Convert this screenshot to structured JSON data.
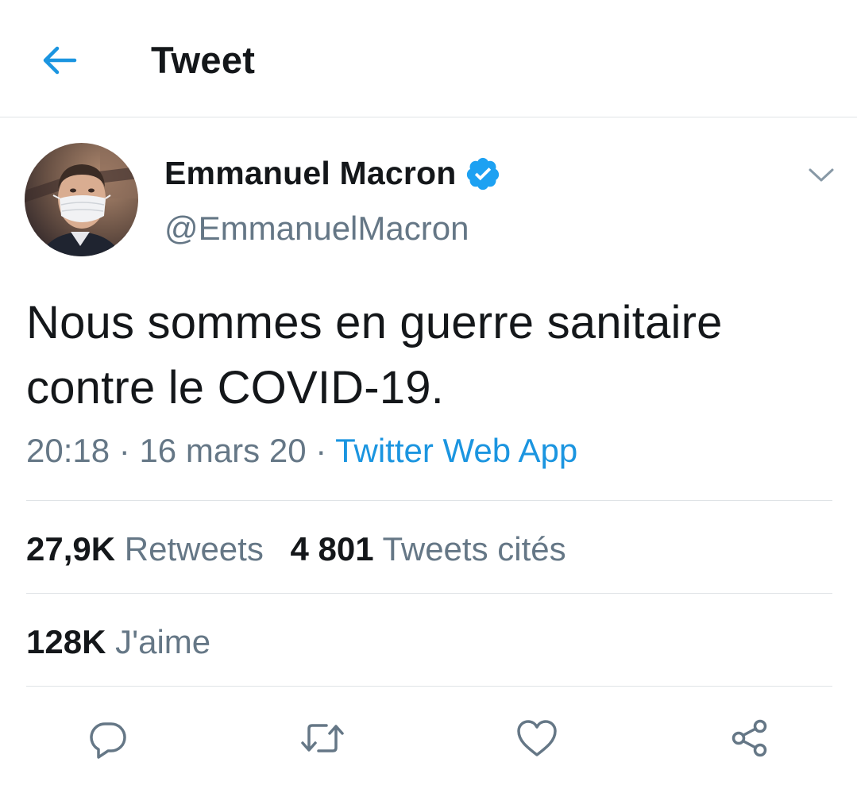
{
  "header": {
    "back_icon": "arrow-left-icon",
    "title": "Tweet",
    "accent_color": "#1b95e0"
  },
  "author": {
    "name": "Emmanuel Macron",
    "handle": "@EmmanuelMacron",
    "verified": true,
    "verified_color": "#1da1f2",
    "avatar_icon": "profile-photo"
  },
  "tweet": {
    "line1": "Nous sommes en guerre sanitaire",
    "line2": "contre le COVID-19.",
    "time": "20:18",
    "date": "16 mars 20",
    "separator": "·",
    "source": "Twitter Web App"
  },
  "stats": {
    "retweets_count": "27,9K",
    "retweets_label": "Retweets",
    "quotes_count": "4 801",
    "quotes_label": "Tweets cités",
    "likes_count": "128K",
    "likes_label": "J'aime"
  },
  "actions": [
    {
      "icon": "reply-icon"
    },
    {
      "icon": "retweet-icon"
    },
    {
      "icon": "like-icon"
    },
    {
      "icon": "share-icon"
    }
  ]
}
